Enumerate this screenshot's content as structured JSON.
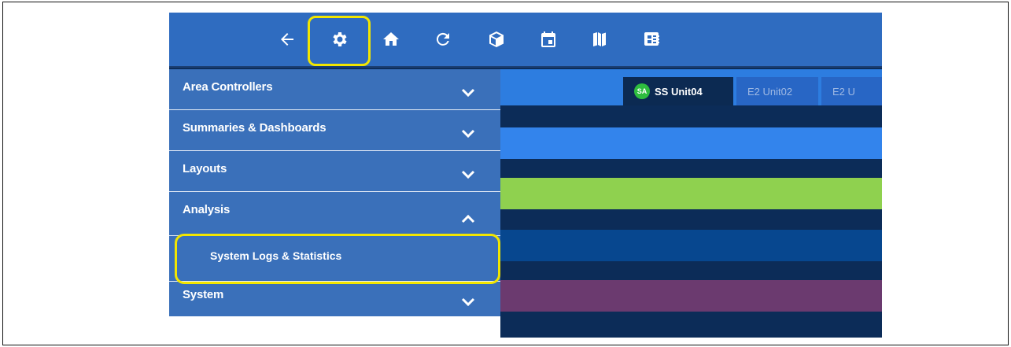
{
  "toolbar": {
    "buttons": [
      {
        "name": "back-arrow-icon"
      },
      {
        "name": "gear-icon"
      },
      {
        "name": "home-icon"
      },
      {
        "name": "refresh-icon"
      },
      {
        "name": "cube-icon"
      },
      {
        "name": "calendar-icon"
      },
      {
        "name": "map-icon"
      },
      {
        "name": "dashboard-icon"
      }
    ]
  },
  "menu": {
    "items": [
      {
        "label": "Area Controllers",
        "expanded": false
      },
      {
        "label": "Summaries & Dashboards",
        "expanded": false
      },
      {
        "label": "Layouts",
        "expanded": false
      },
      {
        "label": "Analysis",
        "expanded": true
      },
      {
        "label": "System",
        "expanded": false
      }
    ],
    "analysis_subitems": [
      {
        "label": "System Logs & Statistics"
      }
    ]
  },
  "tabs": [
    {
      "badge": "SA",
      "label": "SS Unit04",
      "active": true
    },
    {
      "label": "E2 Unit02",
      "active": false
    },
    {
      "label": "E2 U",
      "active": false
    }
  ],
  "colors": {
    "highlight": "#f2e600",
    "toolbar": "#2f6cc0",
    "menu": "#3a70ba",
    "band_blue": "#3384ec",
    "band_green": "#8fd14f",
    "band_purple": "#6b3a6f",
    "band_mid": "#07478f"
  }
}
